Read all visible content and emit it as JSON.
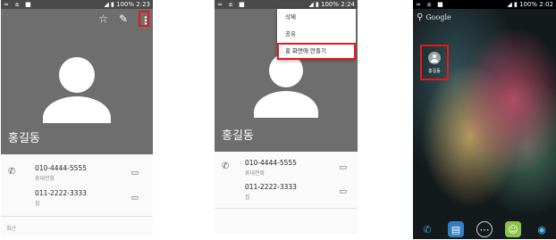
{
  "colors": {
    "highlight": "#e41a1a",
    "header_gray": "#6e6e6e",
    "status_bar": "#4a4a4a"
  },
  "screen1": {
    "status": {
      "left_icons": "≈ ± ■",
      "right": "◢ ▮ 100% 2:23"
    },
    "actions": {
      "star_icon": "☆",
      "edit_icon": "✎",
      "overflow_icon": "⋮"
    },
    "contact_name": "홍길동",
    "phones": [
      {
        "number": "010-4444-5555",
        "label": "휴대전화"
      },
      {
        "number": "011-2222-3333",
        "label": "집"
      }
    ],
    "recent_label": "최근"
  },
  "screen2": {
    "status": {
      "left_icons": "≈ ± ■",
      "right": "◢ ▮ 100% 2:24"
    },
    "menu": [
      "삭제",
      "공유",
      "홈 화면에 만들기"
    ],
    "contact_name": "홍길동",
    "phones": [
      {
        "number": "010-4444-5555",
        "label": "휴대전화"
      },
      {
        "number": "011-2222-3333",
        "label": "집"
      }
    ]
  },
  "screen3": {
    "status": {
      "left_icons": "≈ ± ■",
      "right": "◢ ▮ 100% 2:02"
    },
    "search_text": "Google",
    "shortcut_label": "홍길동",
    "dock_icons": [
      "phone-icon",
      "contacts-icon",
      "apps-icon",
      "messaging-icon",
      "browser-icon"
    ]
  }
}
